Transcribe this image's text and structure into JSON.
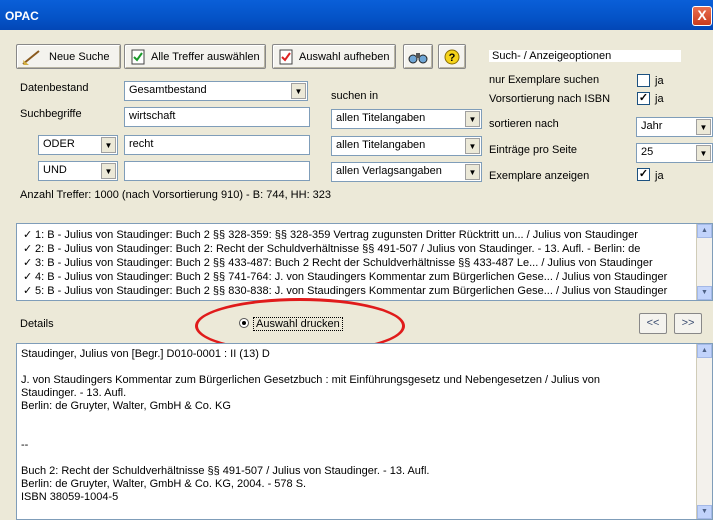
{
  "window": {
    "title": "OPAC",
    "close_label": "X"
  },
  "toolbar": {
    "new_search": "Neue Suche",
    "select_all": "Alle Treffer auswählen",
    "clear_selection": "Auswahl aufheben"
  },
  "options": {
    "header": "Such- / Anzeigeoptionen",
    "only_copies": "nur Exemplare suchen",
    "only_copies_value": "ja",
    "presort_isbn": "Vorsortierung nach ISBN",
    "presort_isbn_value": "ja",
    "sort_by": "sortieren nach",
    "sort_by_value": "Jahr",
    "entries_per_page": "Einträge pro Seite",
    "entries_per_page_value": "25",
    "show_copies": "Exemplare anzeigen",
    "show_copies_value": "ja"
  },
  "search": {
    "holdings_label": "Datenbestand",
    "holdings_value": "Gesamtbestand",
    "terms_label": "Suchbegriffe",
    "search_in_label": "suchen in",
    "rows": [
      {
        "operator": "",
        "term": "wirtschaft",
        "field": "allen Titelangaben"
      },
      {
        "operator": "ODER",
        "term": "recht",
        "field": "allen Titelangaben"
      },
      {
        "operator": "UND",
        "term": "",
        "field": "allen Verlagsangaben"
      }
    ],
    "hits": "Anzahl Treffer: 1000 (nach Vorsortierung 910) - B: 744, HH: 323"
  },
  "results": [
    "1: B - Julius von Staudinger: Buch 2 §§ 328-359: §§ 328-359 Vertrag zugunsten Dritter Rücktritt un... / Julius von Staudinger",
    "2: B - Julius von Staudinger: Buch 2: Recht der Schuldverhältnisse §§ 491-507 / Julius von Staudinger. - 13. Aufl. - Berlin: de",
    "3: B - Julius von Staudinger: Buch 2 §§ 433-487: Buch 2 Recht der Schuldverhältnisse §§ 433-487 Le... / Julius von Staudinger",
    "4: B - Julius von Staudinger: Buch 2 §§ 741-764: J. von Staudingers Kommentar zum Bürgerlichen Gese... / Julius von Staudinger",
    "5: B - Julius von Staudinger: Buch 2 §§ 830-838: J. von Staudingers Kommentar zum Bürgerlichen Gese... / Julius von Staudinger"
  ],
  "details": {
    "label": "Details",
    "print_label": "Auswahl drucken",
    "prev": "<<",
    "next": ">>",
    "lines": [
      "Staudinger, Julius von [Begr.]   D010-0001 : II (13) D",
      "",
      "J. von Staudingers Kommentar zum Bürgerlichen Gesetzbuch : mit Einführungsgesetz und Nebengesetzen / Julius von",
      "Staudinger. - 13. Aufl.",
      "Berlin: de Gruyter, Walter, GmbH & Co. KG",
      "",
      "",
      "--",
      "",
      "Buch 2: Recht der Schuldverhältnisse §§ 491-507 / Julius von Staudinger. - 13. Aufl.",
      "Berlin: de Gruyter, Walter, GmbH & Co. KG, 2004. - 578 S.",
      "ISBN 38059-1004-5"
    ]
  },
  "colors": {
    "titlebar": "#0453c7",
    "highlight_circle": "#e01b1b"
  }
}
